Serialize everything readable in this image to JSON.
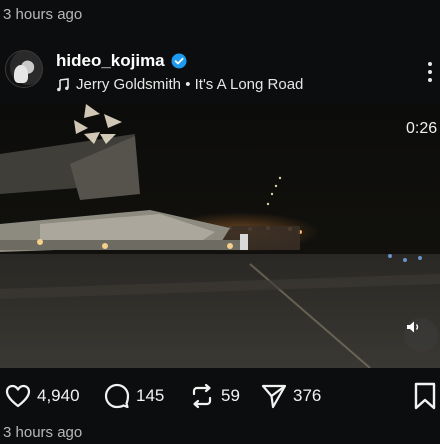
{
  "post": {
    "time_ago_top": "3 hours ago",
    "time_ago_bottom": "3 hours ago",
    "username": "hideo_kojima",
    "verified": true,
    "music": "Jerry Goldsmith • It's A Long Road"
  },
  "video": {
    "duration": "0:26"
  },
  "actions": {
    "likes": "4,940",
    "comments": "145",
    "reposts": "59",
    "shares": "376"
  },
  "icons": {
    "verified": "verified-badge-icon",
    "music": "music-note-icon",
    "more": "more-options-icon",
    "mute": "speaker-icon",
    "like": "heart-icon",
    "comment": "comment-bubble-icon",
    "repost": "repost-icon",
    "share": "send-icon",
    "bookmark": "bookmark-icon"
  },
  "colors": {
    "background": "#0c0d0e",
    "verified": "#1d9bf0",
    "text": "#f2f2f2",
    "muted_text": "#b8b8b8"
  }
}
